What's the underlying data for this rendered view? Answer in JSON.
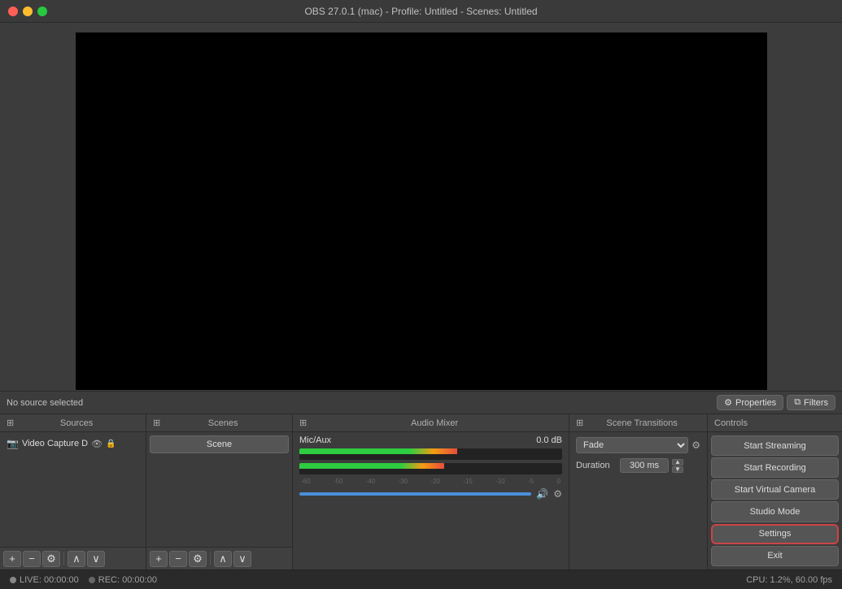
{
  "titlebar": {
    "title": "OBS 27.0.1 (mac)  -  Profile: Untitled  -  Scenes: Untitled"
  },
  "source_bar": {
    "text": "No source selected",
    "properties_label": "Properties",
    "filters_label": "Filters"
  },
  "scenes_panel": {
    "title": "Scenes",
    "items": [
      {
        "label": "Scene"
      }
    ]
  },
  "sources_panel": {
    "title": "Sources",
    "items": [
      {
        "name": "Video Capture D",
        "icon": "📹"
      }
    ]
  },
  "audio_panel": {
    "title": "Audio Mixer",
    "channels": [
      {
        "name": "Mic/Aux",
        "db": "0.0 dB",
        "ticks": [
          "-60",
          "-50",
          "-40",
          "-30",
          "-20",
          "-15",
          "-10",
          "-5",
          "0"
        ]
      }
    ]
  },
  "transitions_panel": {
    "title": "Scene Transitions",
    "transition_value": "Fade",
    "duration_label": "Duration",
    "duration_value": "300 ms"
  },
  "controls_panel": {
    "title": "Controls",
    "buttons": [
      {
        "label": "Start Streaming",
        "id": "start-streaming"
      },
      {
        "label": "Start Recording",
        "id": "start-recording"
      },
      {
        "label": "Start Virtual Camera",
        "id": "start-virtual-camera"
      },
      {
        "label": "Studio Mode",
        "id": "studio-mode"
      },
      {
        "label": "Settings",
        "id": "settings"
      },
      {
        "label": "Exit",
        "id": "exit"
      }
    ]
  },
  "status_bar": {
    "live_label": "LIVE: 00:00:00",
    "rec_label": "REC: 00:00:00",
    "cpu_label": "CPU: 1.2%, 60.00 fps"
  },
  "toolbar": {
    "add": "+",
    "remove": "−",
    "gear": "⚙",
    "up": "∧",
    "down": "∨"
  }
}
